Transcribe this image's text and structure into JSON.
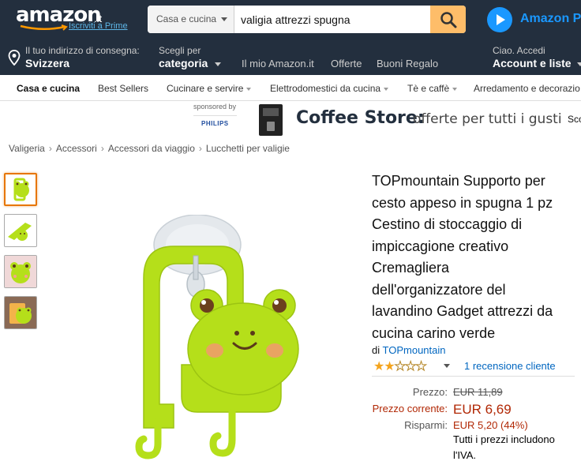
{
  "header": {
    "logo_text": "amazon",
    "logo_tld": ".it",
    "prime_link": "Iscriviti a Prime",
    "search": {
      "category": "Casa e cucina",
      "query": "valigia attrezzi spugna"
    },
    "prime_video": "Amazon Pr",
    "deliver_line1": "Il tuo indirizzo di consegna:",
    "deliver_line2": "Svizzera",
    "category_line1": "Scegli per",
    "category_line2": "categoria",
    "links": [
      "Il mio Amazon.it",
      "Offerte",
      "Buoni Regalo"
    ],
    "account_line1": "Ciao. Accedi",
    "account_line2": "Account e liste"
  },
  "subnav": [
    {
      "label": "Casa e cucina",
      "dropdown": false
    },
    {
      "label": "Best Sellers",
      "dropdown": false
    },
    {
      "label": "Cucinare e servire",
      "dropdown": true
    },
    {
      "label": "Elettrodomestici da cucina",
      "dropdown": true
    },
    {
      "label": "Tè e caffè",
      "dropdown": true
    },
    {
      "label": "Arredamento e decorazio",
      "dropdown": false
    }
  ],
  "banner": {
    "sponsored": "sponsored by",
    "brand": "PHILIPS",
    "title": "Coffee Store:",
    "subtitle": "offerte per tutti i gusti",
    "cut": "Sco"
  },
  "breadcrumbs": [
    "Valigeria",
    "Accessori",
    "Accessori da viaggio",
    "Lucchetti per valigie"
  ],
  "product": {
    "title_lines": [
      "TOPmountain Supporto per",
      "cesto appeso in spugna 1 pz",
      "Cestino di stoccaggio di",
      "impiccagione creativo",
      "Cremagliera",
      "dell'organizzatore del",
      "lavandino Gadget attrezzi da",
      "cucina carino verde"
    ],
    "by_prefix": "di",
    "brand": "TOPmountain",
    "rating_stars": 2,
    "rating_max": 5,
    "reviews": "1 recensione cliente",
    "prices": {
      "list_label": "Prezzo:",
      "list_value": "EUR 11,89",
      "current_label": "Prezzo corrente:",
      "current_value": "EUR 6,69",
      "savings_label": "Risparmi:",
      "savings_value": "EUR 5,20 (44%)",
      "vat_note_1": "Tutti i prezzi includono",
      "vat_note_2": "l'IVA."
    }
  },
  "colors": {
    "header_bg": "#232f3e",
    "frog_green": "#b5df1a",
    "search_button": "#febd69",
    "price_red": "#b12704",
    "link_blue": "#0066c0",
    "star": "#f4a41d"
  }
}
